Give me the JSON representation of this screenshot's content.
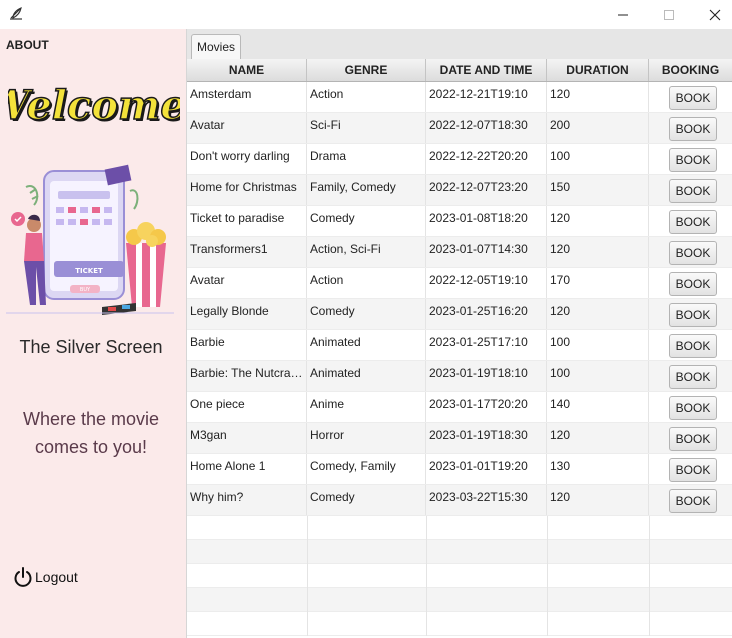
{
  "sidebar": {
    "about_label": "ABOUT",
    "welcome_text": "Welcome!",
    "brand_name": "The Silver Screen",
    "tagline": "Where the movie comes to you!",
    "logout_label": "Logout",
    "illustration_ticket_text": "TICKET",
    "illustration_buy_text": "BUY"
  },
  "tabs": [
    {
      "label": "Movies"
    }
  ],
  "table": {
    "columns": [
      "NAME",
      "GENRE",
      "DATE AND TIME",
      "DURATION",
      "BOOKING"
    ],
    "book_label": "BOOK",
    "rows": [
      {
        "name": "Amsterdam",
        "genre": "Action",
        "datetime": "2022-12-21T19:10",
        "duration": "120"
      },
      {
        "name": "Avatar",
        "genre": "Sci-Fi",
        "datetime": "2022-12-07T18:30",
        "duration": "200"
      },
      {
        "name": "Don't worry darling",
        "genre": "Drama",
        "datetime": "2022-12-22T20:20",
        "duration": "100"
      },
      {
        "name": "Home for Christmas",
        "genre": "Family, Comedy",
        "datetime": "2022-12-07T23:20",
        "duration": "150"
      },
      {
        "name": "Ticket to paradise",
        "genre": "Comedy",
        "datetime": "2023-01-08T18:20",
        "duration": "120"
      },
      {
        "name": "Transformers1",
        "genre": "Action, Sci-Fi",
        "datetime": "2023-01-07T14:30",
        "duration": "120"
      },
      {
        "name": "Avatar",
        "genre": "Action",
        "datetime": "2022-12-05T19:10",
        "duration": "170"
      },
      {
        "name": "Legally Blonde",
        "genre": "Comedy",
        "datetime": "2023-01-25T16:20",
        "duration": "120"
      },
      {
        "name": "Barbie",
        "genre": "Animated",
        "datetime": "2023-01-25T17:10",
        "duration": "100"
      },
      {
        "name": "Barbie: The Nutcrac...",
        "genre": "Animated",
        "datetime": "2023-01-19T18:10",
        "duration": "100"
      },
      {
        "name": "One piece",
        "genre": "Anime",
        "datetime": "2023-01-17T20:20",
        "duration": "140"
      },
      {
        "name": "M3gan",
        "genre": "Horror",
        "datetime": "2023-01-19T18:30",
        "duration": "120"
      },
      {
        "name": "Home Alone 1",
        "genre": "Comedy, Family",
        "datetime": "2023-01-01T19:20",
        "duration": "130"
      },
      {
        "name": "Why him?",
        "genre": "Comedy",
        "datetime": "2023-03-22T15:30",
        "duration": "120"
      }
    ],
    "empty_rows": 5
  },
  "colors": {
    "sidebar_bg": "#fbeaea",
    "welcome_fill": "#f3e23a",
    "welcome_outline": "#1a1a1a",
    "illustration_pink": "#e8678f",
    "illustration_purple": "#6c4fa8",
    "tagline": "#5a3a4a"
  },
  "icons": {
    "app": "feather-icon",
    "minimize": "minimize-icon",
    "maximize": "maximize-icon",
    "close": "close-icon",
    "logout": "power-icon"
  }
}
